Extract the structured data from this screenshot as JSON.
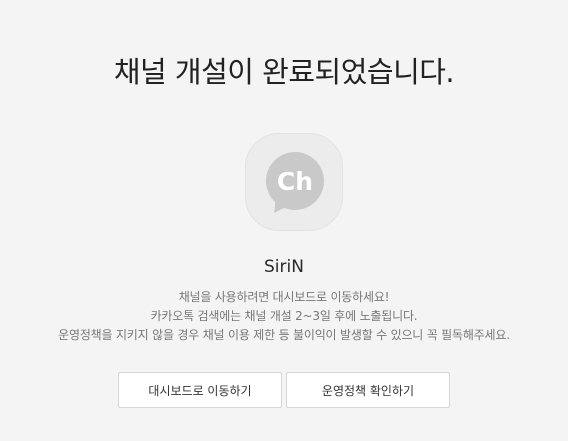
{
  "title": "채널 개설이 완료되었습니다.",
  "channel": {
    "name": "SiriN",
    "profile_icon": "kakao-channel-ch-icon",
    "profile_text": "Ch"
  },
  "description": {
    "line1": "채널을 사용하려면 대시보드로 이동하세요!",
    "line2": "카카오톡 검색에는 채널 개설 2~3일 후에 노출됩니다.",
    "line3": "운영정책을 지키지 않을 경우 채널 이용 제한 등 불이익이 발생할 수 있으니 꼭 필독해주세요."
  },
  "buttons": {
    "dashboard_label": "대시보드로 이동하기",
    "policy_label": "운영정책 확인하기"
  },
  "colors": {
    "background": "#f4f4f4",
    "title_text": "#222222",
    "description_text": "#777777",
    "button_border": "#d6d6d6",
    "icon_gray": "#c9c9c9"
  }
}
